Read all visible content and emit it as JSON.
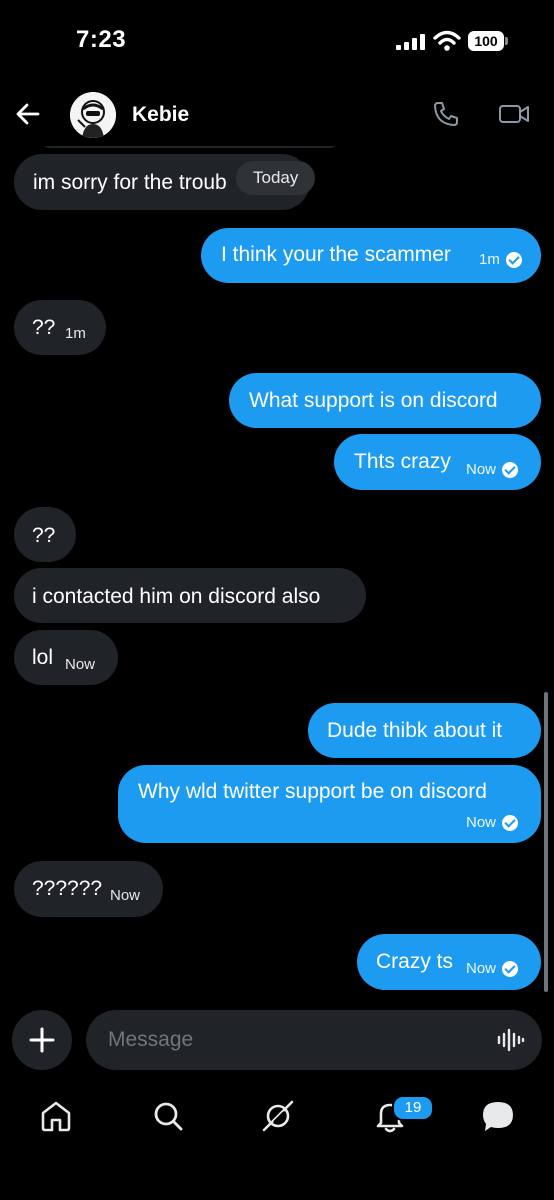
{
  "status_bar": {
    "time": "7:23",
    "battery": "100"
  },
  "header": {
    "contact_name": "Kebie"
  },
  "conversation": {
    "date_separator": "Today",
    "messages": [
      {
        "direction": "in",
        "text": "im sorry for the troub",
        "time": ""
      },
      {
        "direction": "out",
        "text": "I think your the scammer",
        "time": "1m",
        "read": true
      },
      {
        "direction": "in",
        "text": "??",
        "time": "1m"
      },
      {
        "direction": "out",
        "text": "What support is on discord",
        "time": ""
      },
      {
        "direction": "out",
        "text": "Thts crazy",
        "time": "Now",
        "read": true
      },
      {
        "direction": "in",
        "text": "??",
        "time": ""
      },
      {
        "direction": "in",
        "text": "i contacted him on discord also",
        "time": ""
      },
      {
        "direction": "in",
        "text": "lol",
        "time": "Now"
      },
      {
        "direction": "out",
        "text": "Dude thibk about it",
        "time": ""
      },
      {
        "direction": "out",
        "text": "Why wld twitter support be on discord",
        "time": "Now",
        "read": true
      },
      {
        "direction": "in",
        "text": "??????",
        "time": "Now"
      },
      {
        "direction": "out",
        "text": "Crazy ts",
        "time": "Now",
        "read": true
      }
    ]
  },
  "composer": {
    "placeholder": "Message"
  },
  "tabbar": {
    "notification_count": "19",
    "items": [
      "home-icon",
      "search-icon",
      "grok-icon",
      "notifications-icon",
      "messages-icon"
    ]
  },
  "colors": {
    "accent": "#1d9bf0",
    "incoming_bubble": "#202327",
    "background": "#000000"
  }
}
